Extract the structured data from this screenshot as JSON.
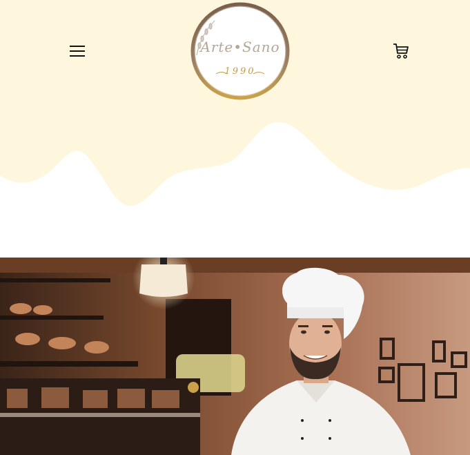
{
  "header": {
    "menu_icon": "hamburger-menu-icon",
    "cart_icon": "shopping-cart-icon",
    "logo": {
      "name": "Arte•Sano",
      "year": "1990",
      "colors": {
        "ring": "#8a6f5a",
        "gold": "#c09a45"
      }
    },
    "background": "#fff7dd"
  },
  "hero": {
    "image": "chef-in-bakery-photo"
  }
}
